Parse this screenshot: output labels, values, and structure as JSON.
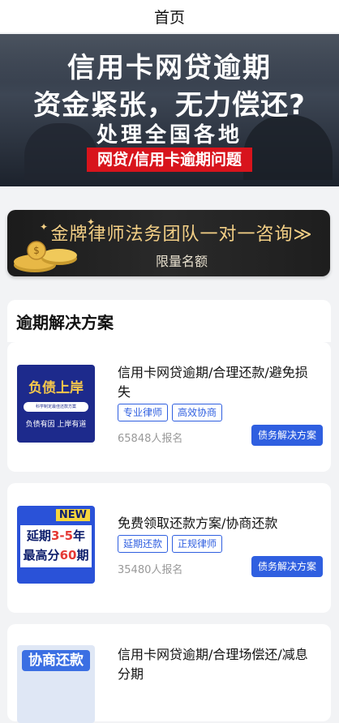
{
  "header": {
    "title": "首页"
  },
  "banner": {
    "line1": "信用卡网贷逾期",
    "line2": "资金紧张，无力偿还?",
    "line3": "处理全国各地",
    "tag": "网贷/信用卡逾期问题"
  },
  "promo": {
    "line1": "金牌律师法务团队一对一咨询≫",
    "line2": "限量名额"
  },
  "section": {
    "title": "逾期解决方案"
  },
  "cards": [
    {
      "title": "信用卡网贷逾期/合理还款/避免损失",
      "tags": [
        "专业律师",
        "高效协商"
      ],
      "count": "65848人报名",
      "button": "债务解决方案",
      "thumb": {
        "line1": "负债上岸",
        "line2": "科学制定最佳还款方案",
        "line3": "负债有因 上岸有道"
      }
    },
    {
      "title": "免费领取还款方案/协商还款",
      "tags": [
        "延期还款",
        "正规律师"
      ],
      "count": "35480人报名",
      "button": "债务解决方案",
      "thumb": {
        "badge": "NEW",
        "line1a": "延期",
        "line1b": "3-5",
        "line1c": "年",
        "line2a": "最高分",
        "line2b": "60",
        "line2c": "期"
      }
    },
    {
      "title": "信用卡网贷逾期/合理场偿还/减息分期",
      "thumb": {
        "line1": "协商还款"
      }
    }
  ]
}
